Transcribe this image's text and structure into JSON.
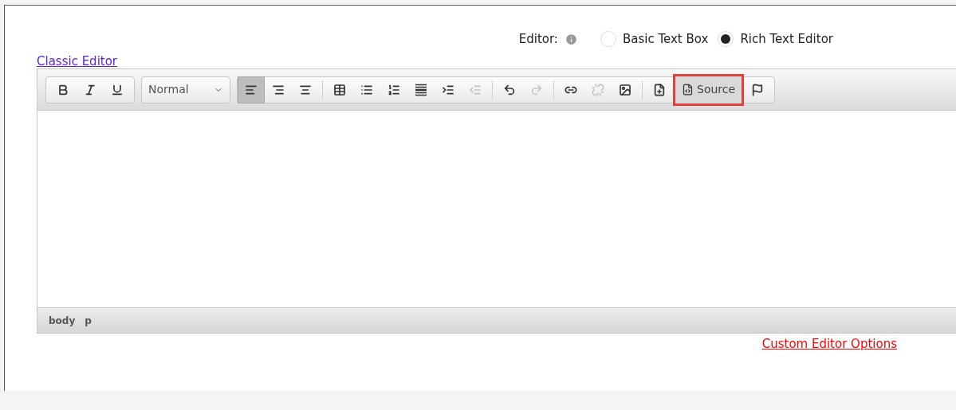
{
  "editor_choice": {
    "label": "Editor:",
    "options": [
      {
        "label": "Basic Text Box",
        "selected": false
      },
      {
        "label": "Rich Text Editor",
        "selected": true
      }
    ]
  },
  "classic_link": "Classic Editor",
  "toolbar": {
    "format": {
      "value": "Normal"
    },
    "alignment": [
      {
        "selected": true
      },
      {
        "selected": false
      },
      {
        "selected": false
      }
    ],
    "insert": [
      {
        "disabled": false
      },
      {
        "disabled": false
      },
      {
        "disabled": false
      },
      {
        "disabled": false
      },
      {
        "disabled": false
      },
      {
        "disabled": true
      }
    ],
    "history": [
      {
        "disabled": false
      },
      {
        "disabled": true
      }
    ],
    "links": [
      {
        "disabled": false
      },
      {
        "disabled": true
      },
      {
        "disabled": false
      }
    ],
    "source": {
      "label": "Source",
      "highlighted": true
    }
  },
  "status_bar": [
    "body",
    "p"
  ],
  "custom_link": "Custom Editor Options"
}
